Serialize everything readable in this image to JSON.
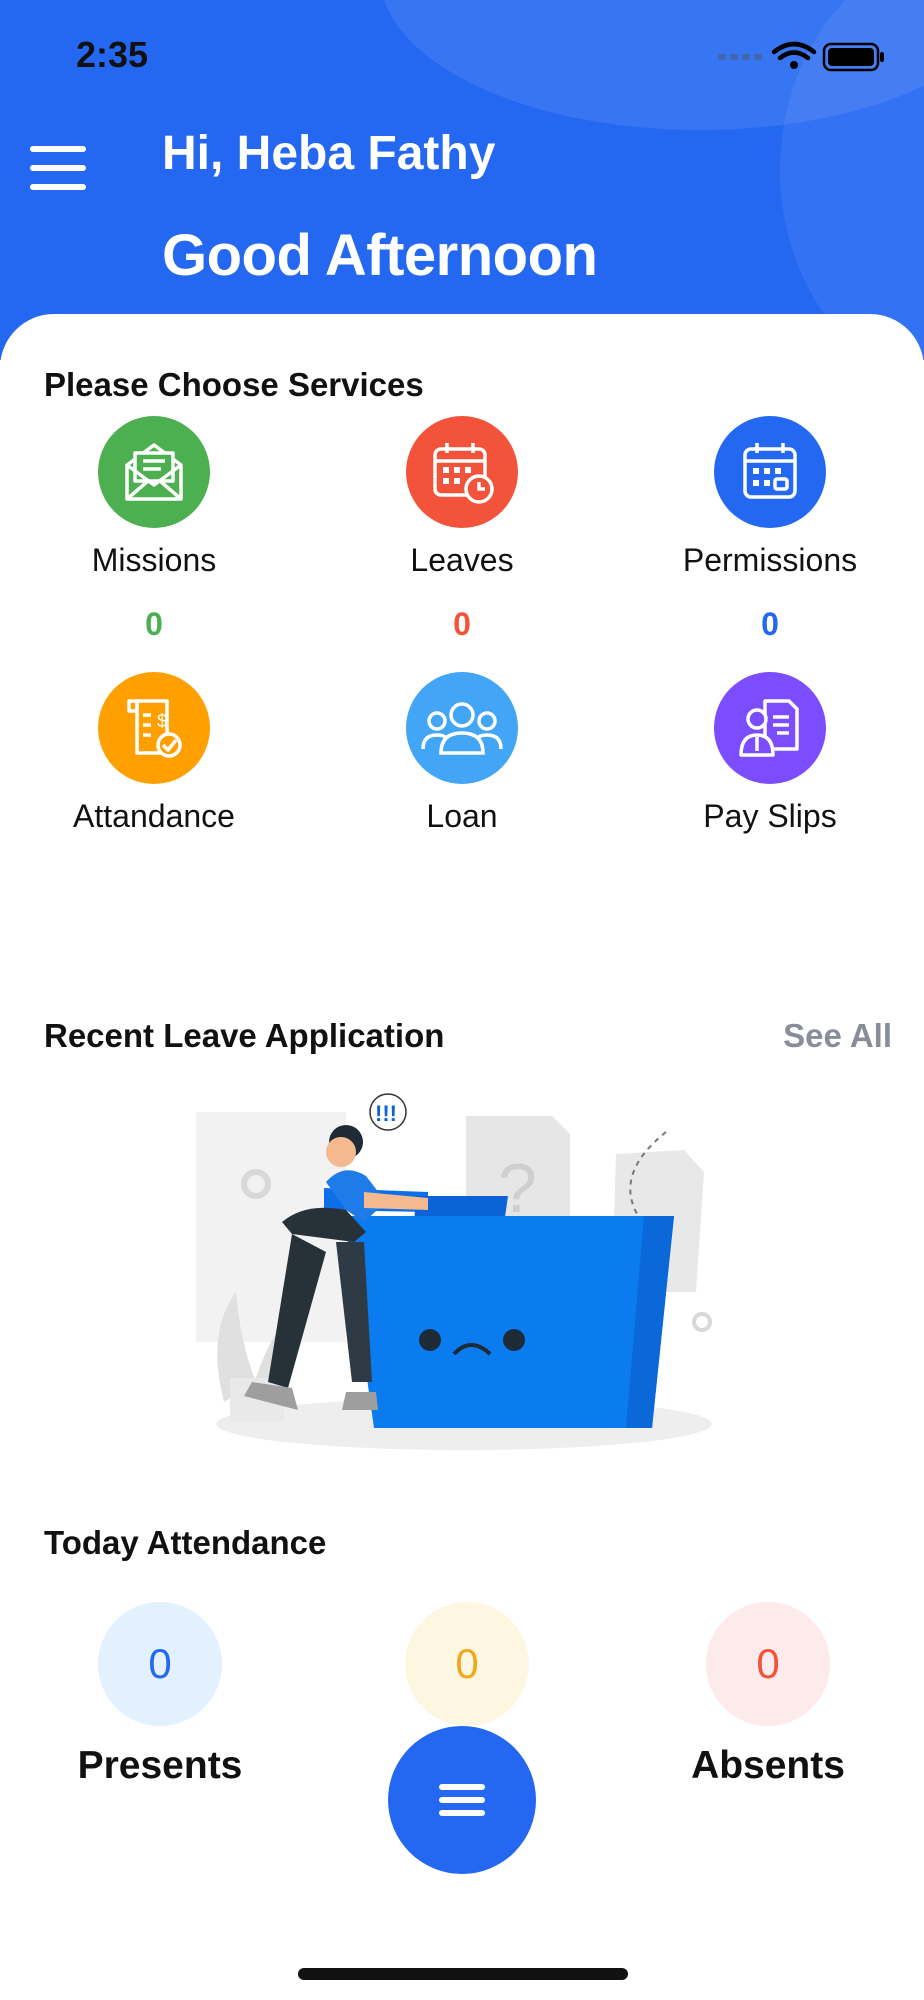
{
  "status_bar": {
    "time": "2:35"
  },
  "header": {
    "greeting": "Hi, Heba Fathy",
    "salutation": "Good Afternoon"
  },
  "services": {
    "title": "Please Choose Services",
    "items": [
      {
        "label": "Missions",
        "count": "0",
        "icon": "envelope-icon",
        "color": "#4caf50"
      },
      {
        "label": "Leaves",
        "count": "0",
        "icon": "calendar-clock-icon",
        "color": "#f4533b"
      },
      {
        "label": "Permissions",
        "count": "0",
        "icon": "calendar-icon",
        "color": "#2468f2"
      },
      {
        "label": "Attandance",
        "icon": "invoice-check-icon",
        "color": "#ffa000"
      },
      {
        "label": "Loan",
        "icon": "users-icon",
        "color": "#42a5f5"
      },
      {
        "label": "Pay Slips",
        "icon": "employee-document-icon",
        "color": "#7c4dff"
      }
    ]
  },
  "recent_leave": {
    "title": "Recent Leave Application",
    "see_all": "See All"
  },
  "attendance": {
    "title": "Today Attendance",
    "items": [
      {
        "value": "0",
        "label": "Presents"
      },
      {
        "value": "0",
        "label": ""
      },
      {
        "value": "0",
        "label": "Absents"
      }
    ]
  },
  "colors": {
    "primary": "#2468f2",
    "success": "#4caf50",
    "danger": "#f4533b",
    "warning": "#ffa000",
    "loan": "#42a5f5",
    "violet": "#7c4dff"
  }
}
